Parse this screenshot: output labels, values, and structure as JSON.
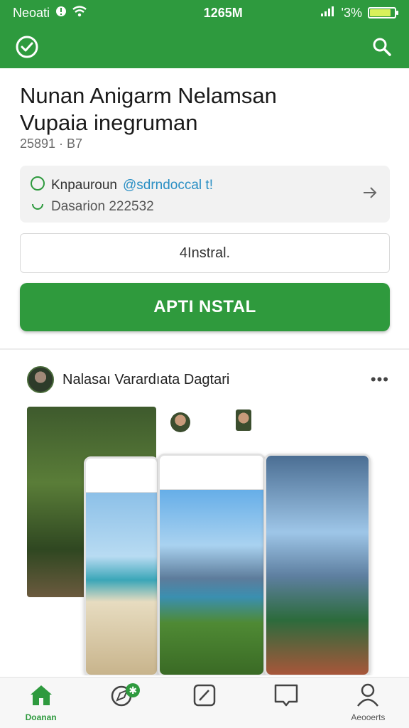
{
  "status_bar": {
    "carrier": "Neoati",
    "time": "1265M",
    "battery_percent": "'3%",
    "battery_level": 0.85,
    "battery_color": "#d8f15a"
  },
  "app_bar": {
    "background": "#2e9a3e",
    "left_icon": "check-circle-icon",
    "right_icon": "search-icon"
  },
  "app": {
    "title_line1": "Nunan Anigarm Nelamsan",
    "title_line2": "Vupaia inegruman",
    "meta": "25891 · B7",
    "info": {
      "row1_text": "Knpauroun",
      "row1_accent": "@sdrndoccal t!",
      "row2_text": "Dasarion 222532"
    },
    "install_outline_label": "4Instral.",
    "install_button_label": "APTI NSTAL"
  },
  "post": {
    "name": "Nalasaı Varardıata Dagtari",
    "menu_icon": "more-horizontal-icon"
  },
  "bottom_nav": {
    "items": [
      {
        "label": "Doanan",
        "icon": "home-icon",
        "active": true
      },
      {
        "label": "",
        "icon": "compass-badge-icon",
        "badge": "✱"
      },
      {
        "label": "",
        "icon": "edit-note-icon"
      },
      {
        "label": "",
        "icon": "message-icon"
      },
      {
        "label": "Aeooerts",
        "icon": "account-icon"
      }
    ]
  }
}
